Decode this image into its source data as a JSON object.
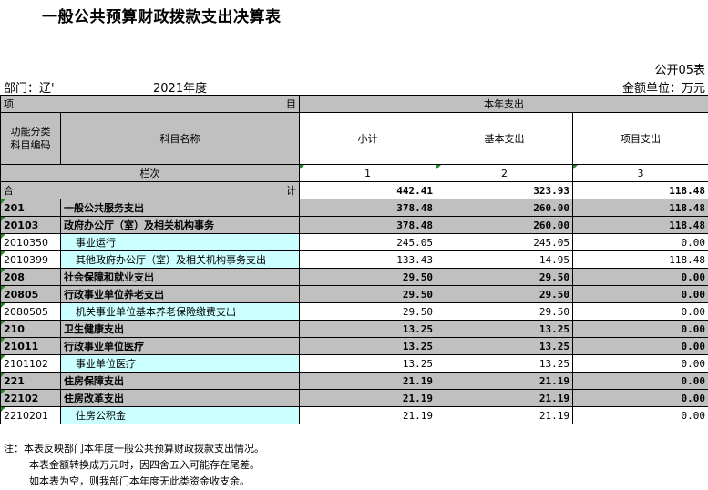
{
  "title": "一般公共预算财政拨款支出决算表",
  "form_code": "公开05表",
  "department": "部门：辽'",
  "year": "2021年度",
  "unit": "金额单位：万元",
  "header": {
    "item": "项",
    "item_right": "目",
    "current_year": "本年支出",
    "func_code": [
      "功能分类",
      "科目编码"
    ],
    "subject_name": "科目名称",
    "subtotal": "小计",
    "basic": "基本支出",
    "project": "项目支出",
    "column_no": "栏次",
    "col1": "1",
    "col2": "2",
    "col3": "3"
  },
  "total": {
    "left": "合",
    "right": "计",
    "subtotal": "442.41",
    "basic": "323.93",
    "project": "118.48"
  },
  "rows": [
    {
      "code": "201",
      "name": "一般公共服务支出",
      "subtotal": "378.48",
      "basic": "260.00",
      "project": "118.48",
      "level": 1
    },
    {
      "code": "20103",
      "name": "政府办公厅（室）及相关机构事务",
      "subtotal": "378.48",
      "basic": "260.00",
      "project": "118.48",
      "level": 2
    },
    {
      "code": "2010350",
      "name": "事业运行",
      "subtotal": "245.05",
      "basic": "245.05",
      "project": "0.00",
      "level": 3
    },
    {
      "code": "2010399",
      "name": "其他政府办公厅（室）及相关机构事务支出",
      "subtotal": "133.43",
      "basic": "14.95",
      "project": "118.48",
      "level": 3
    },
    {
      "code": "208",
      "name": "社会保障和就业支出",
      "subtotal": "29.50",
      "basic": "29.50",
      "project": "0.00",
      "level": 1
    },
    {
      "code": "20805",
      "name": "行政事业单位养老支出",
      "subtotal": "29.50",
      "basic": "29.50",
      "project": "0.00",
      "level": 2
    },
    {
      "code": "2080505",
      "name": "机关事业单位基本养老保险缴费支出",
      "subtotal": "29.50",
      "basic": "29.50",
      "project": "0.00",
      "level": 3
    },
    {
      "code": "210",
      "name": "卫生健康支出",
      "subtotal": "13.25",
      "basic": "13.25",
      "project": "0.00",
      "level": 1
    },
    {
      "code": "21011",
      "name": "行政事业单位医疗",
      "subtotal": "13.25",
      "basic": "13.25",
      "project": "0.00",
      "level": 2
    },
    {
      "code": "2101102",
      "name": "事业单位医疗",
      "subtotal": "13.25",
      "basic": "13.25",
      "project": "0.00",
      "level": 3
    },
    {
      "code": "221",
      "name": "住房保障支出",
      "subtotal": "21.19",
      "basic": "21.19",
      "project": "0.00",
      "level": 1
    },
    {
      "code": "22102",
      "name": "住房改革支出",
      "subtotal": "21.19",
      "basic": "21.19",
      "project": "0.00",
      "level": 2
    },
    {
      "code": "2210201",
      "name": "住房公积金",
      "subtotal": "21.19",
      "basic": "21.19",
      "project": "0.00",
      "level": 3
    }
  ],
  "notes": [
    "注：本表反映部门本年度一般公共预算财政拨款支出情况。",
    "本表金额转换成万元时，因四舍五入可能存在尾差。",
    "如本表为空，则我部门本年度无此类资金收支余。"
  ]
}
